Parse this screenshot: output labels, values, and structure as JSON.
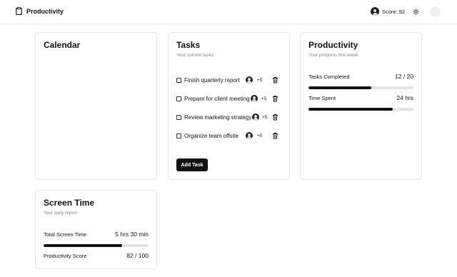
{
  "header": {
    "title": "Productivity",
    "score": "Score: 92",
    "icons": {
      "brand": "clipboard-icon",
      "avatar": "user-icon",
      "theme": "sun-icon"
    }
  },
  "calendar": {
    "title": "Calendar"
  },
  "tasks": {
    "title": "Tasks",
    "subtitle": "Your current tasks",
    "items": [
      {
        "label": "Finish quarterly report",
        "extra": "+5"
      },
      {
        "label": "Prepare for client meeting",
        "extra": "+5"
      },
      {
        "label": "Review marketing strategy",
        "extra": "+5"
      },
      {
        "label": "Organize team offsite",
        "extra": "+5"
      }
    ],
    "add_button": "Add Task"
  },
  "productivity": {
    "title": "Productivity",
    "subtitle": "Your progress this week",
    "metrics": [
      {
        "label": "Tasks Completed",
        "value": "12 / 20",
        "progress": 0.6
      },
      {
        "label": "Time Spent",
        "value": "24 hrs",
        "progress": 0.8
      }
    ]
  },
  "screen_time": {
    "title": "Screen Time",
    "subtitle": "Your daily report",
    "metrics": [
      {
        "label": "Total Screen Time",
        "value": "5 hrs 30 min",
        "progress": 0.75
      },
      {
        "label": "Productivity Score",
        "value": "82 / 100"
      }
    ]
  }
}
